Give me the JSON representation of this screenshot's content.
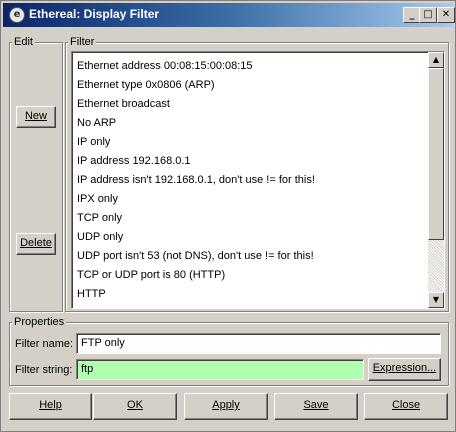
{
  "window": {
    "title": "Ethereal: Display Filter",
    "controls": {
      "minimize": "_",
      "maximize": "□",
      "close": "✕"
    }
  },
  "edit_group": {
    "label": "Edit",
    "new_button": "New",
    "delete_button": "Delete"
  },
  "filter_group": {
    "label": "Filter",
    "items": [
      "Ethernet address 00:08:15:00:08:15",
      "Ethernet type 0x0806 (ARP)",
      "Ethernet broadcast",
      "No ARP",
      "IP only",
      "IP address 192.168.0.1",
      "IP address isn't 192.168.0.1, don't use != for this!",
      "IPX only",
      "TCP only",
      "UDP only",
      "UDP port isn't 53 (not DNS), don't use != for this!",
      "TCP or UDP port is 80 (HTTP)",
      "HTTP"
    ]
  },
  "properties": {
    "label": "Properties",
    "filter_name_label": "Filter name:",
    "filter_name_value": "FTP only",
    "filter_string_label": "Filter string:",
    "filter_string_value": "ftp",
    "filter_string_color": "#afffaf",
    "expression_button": "Expression..."
  },
  "buttons": {
    "help": "Help",
    "ok": "OK",
    "apply": "Apply",
    "save": "Save",
    "close": "Close"
  }
}
